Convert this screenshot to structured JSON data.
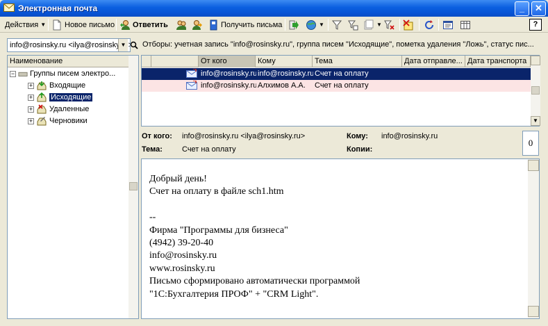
{
  "window": {
    "title": "Электронная почта",
    "min_glyph": "_",
    "close_glyph": "✕"
  },
  "toolbar": {
    "actions_label": "Действия",
    "new_letter_label": "Новое письмо",
    "reply_label": "Ответить",
    "receive_label": "Получить письма",
    "help_label": "?"
  },
  "filter": {
    "account_value": "info@rosinsky.ru <ilya@rosinsky.ru>",
    "filters_text": "Отборы: учетная запись \"info@rosinsky.ru\", группа писем \"Исходящие\", пометка удаления \"Ложь\", статус пис..."
  },
  "tree": {
    "header": "Наименование",
    "root_label": "Группы писем электро...",
    "items": [
      {
        "label": "Входящие"
      },
      {
        "label": "Исходящие"
      },
      {
        "label": "Удаленные"
      },
      {
        "label": "Черновики"
      }
    ]
  },
  "grid": {
    "columns": [
      "От кого",
      "Кому",
      "Тема",
      "Дата отправле...",
      "Дата транспорта"
    ],
    "rows": [
      {
        "from": "info@rosinsky.ru",
        "to": "info@rosinsky.ru",
        "subject": "Счет на оплату"
      },
      {
        "from": "info@rosinsky.ru",
        "to": "Алхимов А.А.",
        "subject": "Счет на оплату"
      }
    ]
  },
  "message": {
    "from_label": "От кого:",
    "from_value": "info@rosinsky.ru <ilya@rosinsky.ru>",
    "to_label": "Кому:",
    "to_value": "info@rosinsky.ru",
    "subject_label": "Тема:",
    "subject_value": "Счет на оплату",
    "copies_label": "Копии:",
    "attachments_count": "0",
    "body": "Добрый день!\nСчет на оплату в файле sch1.htm\n\n--\nФирма \"Программы для бизнеса\"\n(4942) 39-20-40\ninfo@rosinsky.ru\nwww.rosinsky.ru\nПисьмо сформировано автоматически программой\n\"1С:Бухгалтерия ПРОФ\" + \"CRM Light\"."
  },
  "colors": {
    "selection": "#0A246A",
    "row_highlight": "#FCE4E4",
    "titlebar": "#0A5FE0"
  }
}
